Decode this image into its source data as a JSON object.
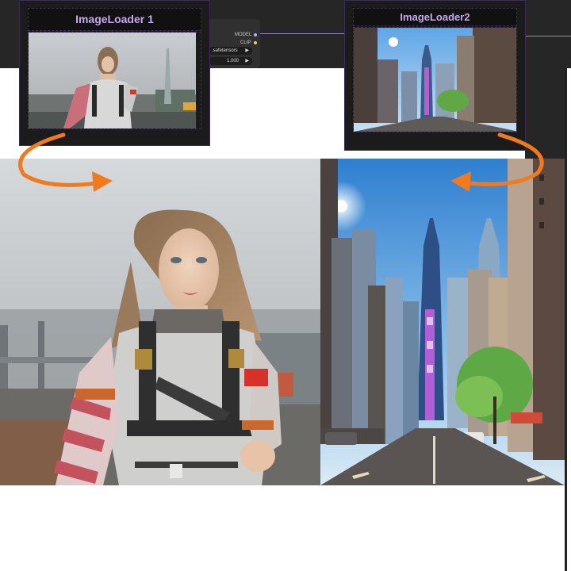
{
  "nodes": {
    "loader1": {
      "title": "ImageLoader 1"
    },
    "loader2": {
      "title": "ImageLoader2"
    }
  },
  "hidden_node": {
    "outputs": [
      "MODEL",
      "CLIP"
    ],
    "widgets": [
      {
        "value": ".safetensors",
        "arrow": "▶"
      },
      {
        "value": "1.000",
        "arrow": "▶"
      }
    ]
  },
  "colors": {
    "canvas_bg": "#262626",
    "node_bg": "#1b1b1b",
    "title_text": "#c8a7f0",
    "arrow": "#f07a1e",
    "wire": "#9a8cc5"
  },
  "images": {
    "preview_left": "woman-running-in-harness-suit",
    "preview_right": "city-street-skyscrapers"
  }
}
